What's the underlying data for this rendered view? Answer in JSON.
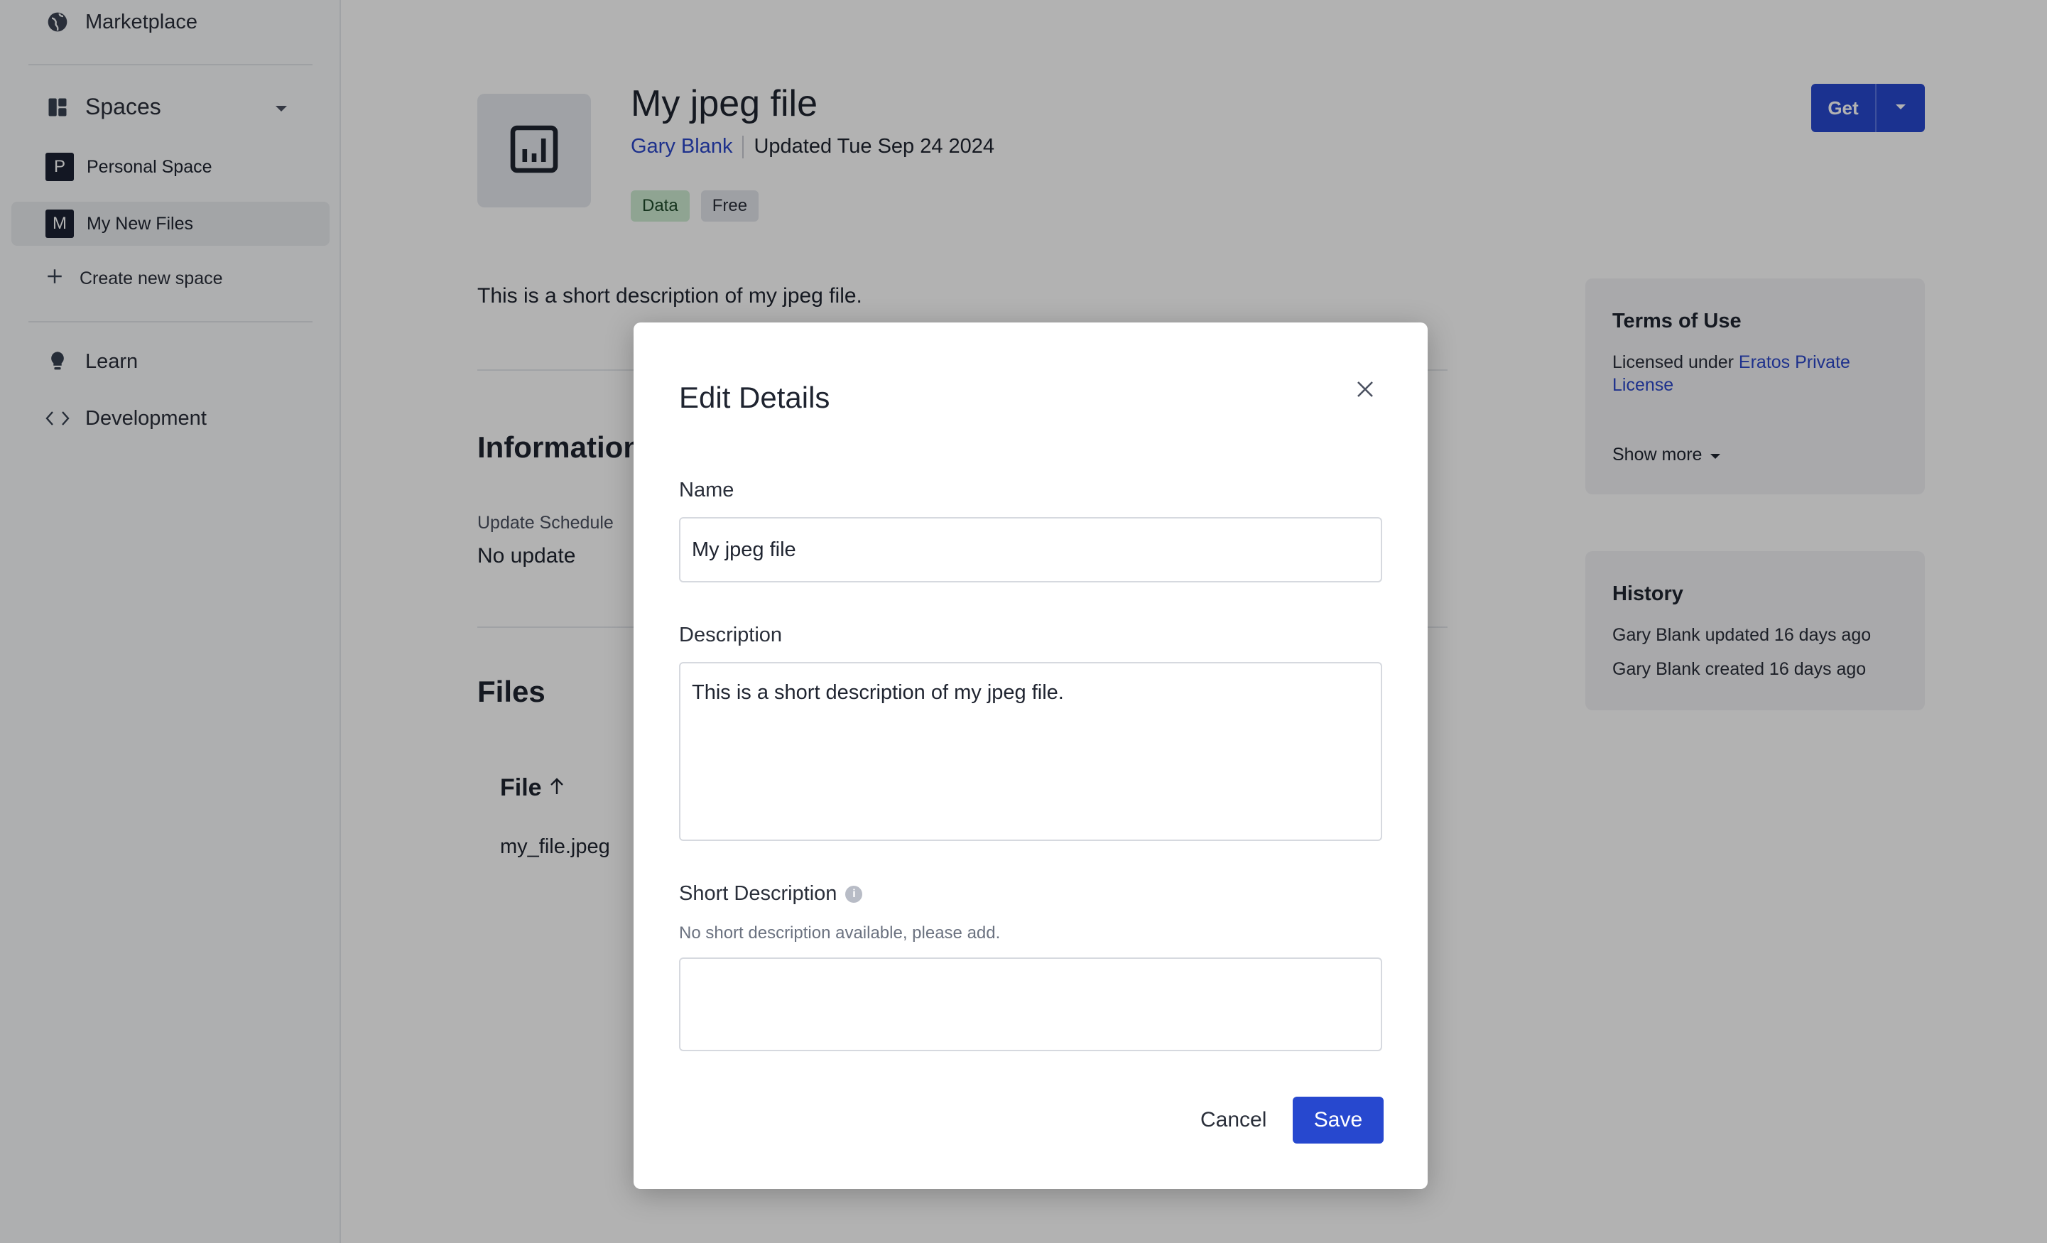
{
  "sidebar": {
    "marketplace": "Marketplace",
    "spaces": "Spaces",
    "items": [
      {
        "badge": "P",
        "label": "Personal Space"
      },
      {
        "badge": "M",
        "label": "My New Files"
      }
    ],
    "create_space": "Create new space",
    "learn": "Learn",
    "development": "Development"
  },
  "asset": {
    "title": "My jpeg file",
    "author": "Gary Blank",
    "updated": "Updated Tue Sep 24 2024",
    "tags": [
      "Data",
      "Free"
    ],
    "get_label": "Get",
    "description": "This is a short description of my jpeg file."
  },
  "information": {
    "title": "Information",
    "update_schedule_label": "Update Schedule",
    "update_schedule_value": "No update"
  },
  "files": {
    "title": "Files",
    "column": "File",
    "rows": [
      "my_file.jpeg"
    ]
  },
  "terms": {
    "title": "Terms of Use",
    "licensed_prefix": "Licensed under",
    "license_line1": "Eratos Private",
    "license_line2": "License",
    "show_more": "Show more"
  },
  "history": {
    "title": "History",
    "entries": [
      "Gary Blank updated 16 days ago",
      "Gary Blank created 16 days ago"
    ]
  },
  "modal": {
    "title": "Edit Details",
    "name_label": "Name",
    "name_value": "My jpeg file",
    "description_label": "Description",
    "description_value": "This is a short description of my jpeg file.",
    "short_description_label": "Short Description",
    "short_description_hint": "No short description available, please add.",
    "short_description_value": "",
    "cancel_label": "Cancel",
    "save_label": "Save"
  }
}
